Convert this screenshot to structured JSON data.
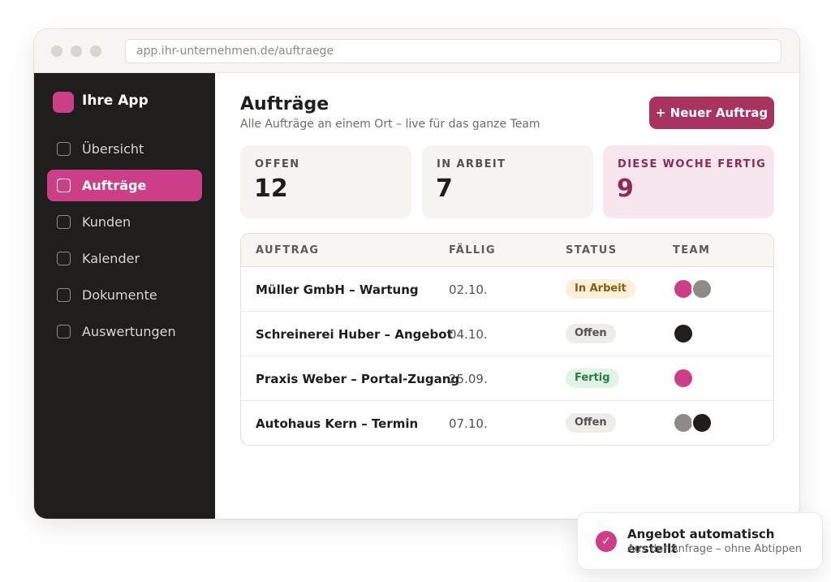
{
  "browser": {
    "url": "app.ihr-unternehmen.de/auftraege"
  },
  "sidebar": {
    "brand": "Ihre App",
    "items": [
      {
        "label": "Übersicht",
        "active": false
      },
      {
        "label": "Aufträge",
        "active": true
      },
      {
        "label": "Kunden",
        "active": false
      },
      {
        "label": "Kalender",
        "active": false
      },
      {
        "label": "Dokumente",
        "active": false
      },
      {
        "label": "Auswertungen",
        "active": false
      }
    ]
  },
  "header": {
    "title": "Aufträge",
    "subtitle": "Alle Aufträge an einem Ort – live für das ganze Team",
    "new_button": "+ Neuer Auftrag"
  },
  "stats": [
    {
      "label": "OFFEN",
      "value": "12"
    },
    {
      "label": "IN ARBEIT",
      "value": "7"
    },
    {
      "label": "DIESE WOCHE FERTIG",
      "value": "9"
    }
  ],
  "table": {
    "columns": [
      "AUFTRAG",
      "FÄLLIG",
      "STATUS",
      "TEAM"
    ],
    "rows": [
      {
        "name": "Müller GmbH – Wartung",
        "due": "02.10.",
        "status": "In Arbeit",
        "status_kind": "arbeit",
        "team": [
          "#cc3f86",
          "#8e8a86"
        ]
      },
      {
        "name": "Schreinerei Huber – Angebot",
        "due": "04.10.",
        "status": "Offen",
        "status_kind": "offen",
        "team": [
          "#1f1e1d"
        ]
      },
      {
        "name": "Praxis Weber – Portal-Zugang",
        "due": "25.09.",
        "status": "Fertig",
        "status_kind": "fertig",
        "team": [
          "#cc3f86"
        ]
      },
      {
        "name": "Autohaus Kern – Termin",
        "due": "07.10.",
        "status": "Offen",
        "status_kind": "offen",
        "team": [
          "#8e8a86",
          "#1f1e1d"
        ]
      }
    ]
  },
  "toast": {
    "title": "Angebot automatisch erstellt",
    "subtitle": "Aus der Anfrage – ohne Abtippen",
    "icon": "check-icon"
  },
  "colors": {
    "accent": "#cc3f86",
    "button": "#a8335f",
    "sidebar": "#1f1e1d"
  }
}
